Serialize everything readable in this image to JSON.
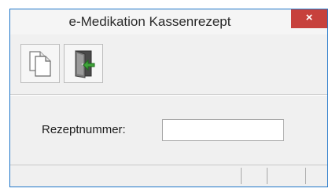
{
  "window": {
    "title": "e-Medikation Kassenrezept",
    "close_glyph": "×"
  },
  "toolbar": {
    "buttons": [
      {
        "icon": "copy-documents-icon"
      },
      {
        "icon": "exit-door-icon"
      }
    ]
  },
  "form": {
    "rezeptnummer_label": "Rezeptnummer:",
    "rezeptnummer_value": ""
  },
  "colors": {
    "close_button": "#c7413c",
    "window_border": "#1f75c9",
    "background": "#f0f0f0"
  }
}
